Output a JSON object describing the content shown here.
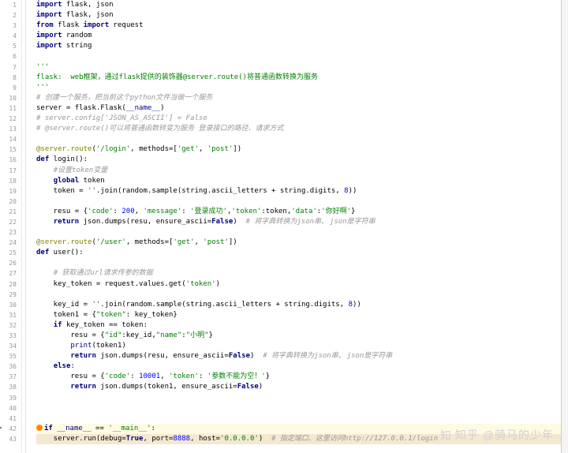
{
  "watermark": "知乎 @骑马的少年",
  "lines": [
    {
      "n": 1,
      "seg": [
        {
          "c": "kw",
          "t": "import"
        },
        {
          "t": " flask, json"
        }
      ]
    },
    {
      "n": 2,
      "seg": [
        {
          "c": "kw",
          "t": "import"
        },
        {
          "t": " flask, json"
        }
      ]
    },
    {
      "n": 3,
      "seg": [
        {
          "c": "kw",
          "t": "from"
        },
        {
          "t": " flask "
        },
        {
          "c": "kw",
          "t": "import"
        },
        {
          "t": " request"
        }
      ]
    },
    {
      "n": 4,
      "seg": [
        {
          "c": "kw",
          "t": "import"
        },
        {
          "t": " random"
        }
      ]
    },
    {
      "n": 5,
      "seg": [
        {
          "c": "kw",
          "t": "import"
        },
        {
          "t": " string"
        }
      ]
    },
    {
      "n": 6,
      "seg": []
    },
    {
      "n": 7,
      "seg": [
        {
          "c": "str",
          "t": "'''"
        }
      ]
    },
    {
      "n": 8,
      "seg": [
        {
          "c": "str",
          "t": "flask:  web框架，通过flask提供的装饰器@server.route()将普通函数转换为服务"
        }
      ]
    },
    {
      "n": 9,
      "seg": [
        {
          "c": "str",
          "t": "'''"
        }
      ]
    },
    {
      "n": 10,
      "seg": [
        {
          "c": "cmt",
          "t": "# 创建一个服务，把当前这个python文件当做一个服务"
        }
      ]
    },
    {
      "n": 11,
      "seg": [
        {
          "t": "server = flask.Flask("
        },
        {
          "c": "builtin",
          "t": "__name__"
        },
        {
          "t": ")"
        }
      ]
    },
    {
      "n": 12,
      "seg": [
        {
          "c": "cmt",
          "t": "# server.config['JSON_AS_ASCII'] = False"
        }
      ]
    },
    {
      "n": 13,
      "seg": [
        {
          "c": "cmt",
          "t": "# @server.route()可以将普通函数转变为服务 登录接口的路径、请求方式"
        }
      ]
    },
    {
      "n": 14,
      "seg": []
    },
    {
      "n": 15,
      "seg": [
        {
          "c": "deco",
          "t": "@server.route"
        },
        {
          "t": "("
        },
        {
          "c": "str",
          "t": "'/login'"
        },
        {
          "t": ", methods=["
        },
        {
          "c": "str",
          "t": "'get'"
        },
        {
          "t": ", "
        },
        {
          "c": "str",
          "t": "'post'"
        },
        {
          "t": "])"
        }
      ]
    },
    {
      "n": 16,
      "seg": [
        {
          "c": "kw",
          "t": "def"
        },
        {
          "t": " login():"
        }
      ]
    },
    {
      "n": 17,
      "seg": [
        {
          "t": "    "
        },
        {
          "c": "cmt",
          "t": "#设置token变量"
        }
      ]
    },
    {
      "n": 18,
      "seg": [
        {
          "t": "    "
        },
        {
          "c": "kw",
          "t": "global"
        },
        {
          "t": " token"
        }
      ]
    },
    {
      "n": 19,
      "seg": [
        {
          "t": "    token = "
        },
        {
          "c": "str",
          "t": "''"
        },
        {
          "t": ".join(random.sample(string.ascii_letters + string.digits, "
        },
        {
          "c": "num",
          "t": "8"
        },
        {
          "t": "))"
        }
      ]
    },
    {
      "n": 20,
      "seg": []
    },
    {
      "n": 21,
      "seg": [
        {
          "t": "    resu = {"
        },
        {
          "c": "str",
          "t": "'code'"
        },
        {
          "t": ": "
        },
        {
          "c": "num",
          "t": "200"
        },
        {
          "t": ", "
        },
        {
          "c": "str",
          "t": "'message'"
        },
        {
          "t": ": "
        },
        {
          "c": "str",
          "t": "'登录成功'"
        },
        {
          "t": ","
        },
        {
          "c": "str",
          "t": "'token'"
        },
        {
          "t": ":token,"
        },
        {
          "c": "str",
          "t": "'data'"
        },
        {
          "t": ":"
        },
        {
          "c": "str",
          "t": "'你好啊'"
        },
        {
          "t": "}"
        }
      ]
    },
    {
      "n": 22,
      "seg": [
        {
          "t": "    "
        },
        {
          "c": "kw",
          "t": "return"
        },
        {
          "t": " json.dumps(resu, ensure_ascii="
        },
        {
          "c": "kw",
          "t": "False"
        },
        {
          "t": ")  "
        },
        {
          "c": "cmt",
          "t": "# 将字典转换为json串, json是字符串"
        }
      ]
    },
    {
      "n": 23,
      "seg": []
    },
    {
      "n": 24,
      "seg": [
        {
          "c": "deco",
          "t": "@server.route"
        },
        {
          "t": "("
        },
        {
          "c": "str",
          "t": "'/user'"
        },
        {
          "t": ", methods=["
        },
        {
          "c": "str",
          "t": "'get'"
        },
        {
          "t": ", "
        },
        {
          "c": "str",
          "t": "'post'"
        },
        {
          "t": "])"
        }
      ]
    },
    {
      "n": 25,
      "seg": [
        {
          "c": "kw",
          "t": "def"
        },
        {
          "t": " user():"
        }
      ]
    },
    {
      "n": 26,
      "seg": []
    },
    {
      "n": 27,
      "seg": [
        {
          "t": "    "
        },
        {
          "c": "cmt",
          "t": "# 获取通过url请求传参的数据"
        }
      ]
    },
    {
      "n": 28,
      "seg": [
        {
          "t": "    key_token = request.values.get("
        },
        {
          "c": "str",
          "t": "'token'"
        },
        {
          "t": ")"
        }
      ]
    },
    {
      "n": 29,
      "seg": []
    },
    {
      "n": 30,
      "seg": [
        {
          "t": "    key_id = "
        },
        {
          "c": "str",
          "t": "''"
        },
        {
          "t": ".join(random.sample(string.ascii_letters + string.digits, "
        },
        {
          "c": "num",
          "t": "8"
        },
        {
          "t": "))"
        }
      ]
    },
    {
      "n": 31,
      "seg": [
        {
          "t": "    token1 = {"
        },
        {
          "c": "str",
          "t": "\"token\""
        },
        {
          "t": ": key_token}"
        }
      ]
    },
    {
      "n": 32,
      "seg": [
        {
          "t": "    "
        },
        {
          "c": "kw",
          "t": "if"
        },
        {
          "t": " key_token == token:"
        }
      ]
    },
    {
      "n": 33,
      "seg": [
        {
          "t": "        resu = {"
        },
        {
          "c": "str",
          "t": "\"id\""
        },
        {
          "t": ":key_id,"
        },
        {
          "c": "str",
          "t": "\"name\""
        },
        {
          "t": ":"
        },
        {
          "c": "str",
          "t": "\"小明\""
        },
        {
          "t": "}"
        }
      ]
    },
    {
      "n": 34,
      "seg": [
        {
          "t": "        "
        },
        {
          "c": "builtin",
          "t": "print"
        },
        {
          "t": "(token1)"
        }
      ]
    },
    {
      "n": 35,
      "seg": [
        {
          "t": "        "
        },
        {
          "c": "kw",
          "t": "return"
        },
        {
          "t": " json.dumps(resu, ensure_ascii="
        },
        {
          "c": "kw",
          "t": "False"
        },
        {
          "t": ")  "
        },
        {
          "c": "cmt",
          "t": "# 将字典转换为json串, json是字符串"
        }
      ]
    },
    {
      "n": 36,
      "seg": [
        {
          "t": "    "
        },
        {
          "c": "kw",
          "t": "else"
        },
        {
          "t": ":"
        }
      ]
    },
    {
      "n": 37,
      "seg": [
        {
          "t": "        resu = {"
        },
        {
          "c": "str",
          "t": "'code'"
        },
        {
          "t": ": "
        },
        {
          "c": "num",
          "t": "10001"
        },
        {
          "t": ", "
        },
        {
          "c": "str",
          "t": "'token'"
        },
        {
          "t": ": "
        },
        {
          "c": "str",
          "t": "'参数不能为空！'"
        },
        {
          "t": "}"
        }
      ]
    },
    {
      "n": 38,
      "seg": [
        {
          "t": "        "
        },
        {
          "c": "kw",
          "t": "return"
        },
        {
          "t": " json.dumps(token1, ensure_ascii="
        },
        {
          "c": "kw",
          "t": "False"
        },
        {
          "t": ")"
        }
      ]
    },
    {
      "n": 39,
      "seg": []
    },
    {
      "n": 40,
      "seg": []
    },
    {
      "n": 41,
      "seg": []
    },
    {
      "n": 42,
      "hl": "hl42",
      "bp": true,
      "seg": [
        {
          "c": "kw",
          "t": "if"
        },
        {
          "t": " "
        },
        {
          "c": "builtin",
          "t": "__name__"
        },
        {
          "t": " == "
        },
        {
          "c": "str",
          "t": "'__main__'"
        },
        {
          "t": ":"
        }
      ]
    },
    {
      "n": 43,
      "hl": "hl43",
      "seg": [
        {
          "t": "    server.run(debug="
        },
        {
          "c": "kw",
          "t": "True"
        },
        {
          "t": ", port="
        },
        {
          "c": "num",
          "t": "8888"
        },
        {
          "t": ", host="
        },
        {
          "c": "str",
          "t": "'0.0.0.0'"
        },
        {
          "t": ")  "
        },
        {
          "c": "cmt",
          "t": "# 指定端口、这里访问http://127.0.0.1/login"
        }
      ]
    }
  ]
}
